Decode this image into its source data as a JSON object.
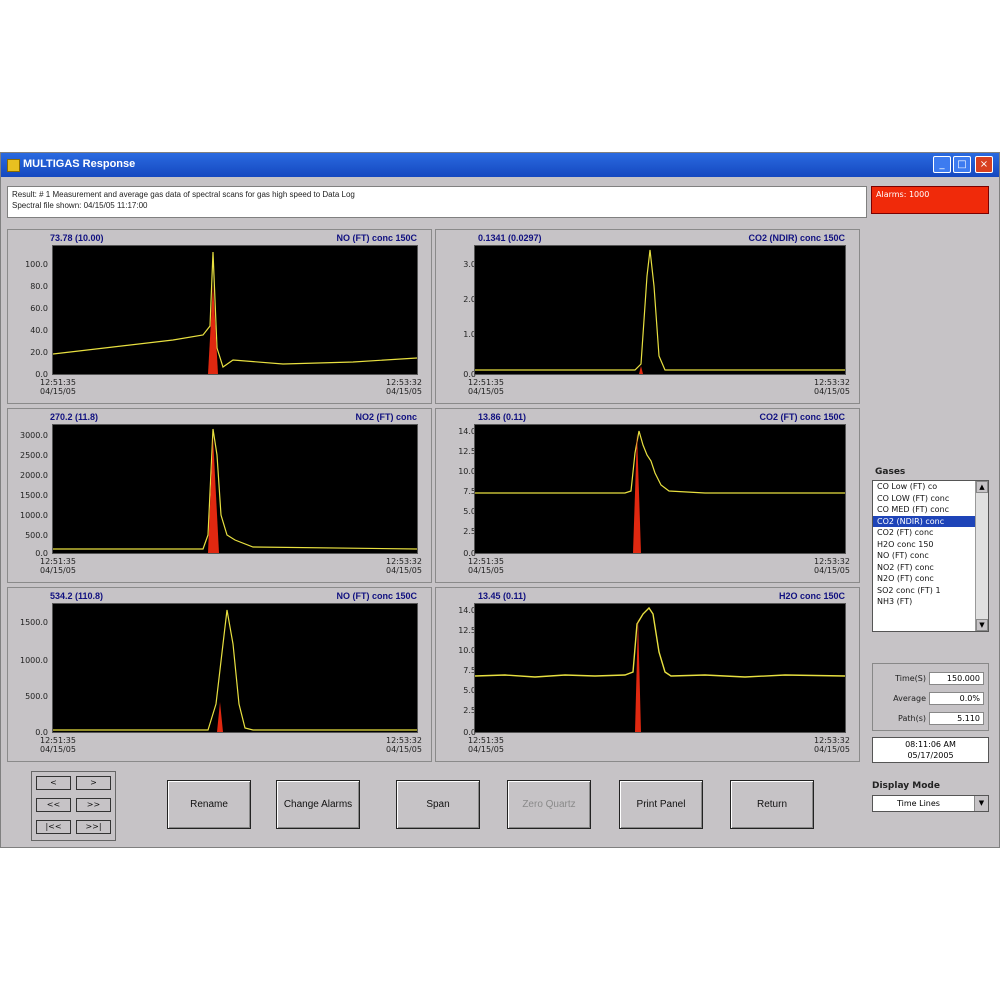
{
  "window": {
    "title": "MULTIGAS Response",
    "buttons": {
      "minimize": "_",
      "maximize": "□",
      "close": "×"
    }
  },
  "info": {
    "line1": "Result: # 1 Measurement and average gas data of spectral scans for gas high speed to Data Log",
    "line2": "Spectral file shown: 04/15/05 11:17:00"
  },
  "alarm": {
    "text": "Alarms: 1000"
  },
  "panels": [
    {
      "value_text": "73.78 (10.00)",
      "name_text": "NO (FT) conc 150C",
      "y_ticks": [
        "100.0",
        "80.0",
        "60.0",
        "40.0",
        "20.0",
        "0.0"
      ],
      "x_start": [
        "12:51:35",
        "04/15/05"
      ],
      "x_end": [
        "12:53:32",
        "04/15/05"
      ]
    },
    {
      "value_text": "0.1341 (0.0297)",
      "name_text": "CO2 (NDIR) conc 150C",
      "y_ticks": [
        "3.0",
        "2.0",
        "1.0",
        "0.0"
      ],
      "x_start": [
        "12:51:35",
        "04/15/05"
      ],
      "x_end": [
        "12:53:32",
        "04/15/05"
      ]
    },
    {
      "value_text": "270.2 (11.8)",
      "name_text": "NO2 (FT) conc",
      "y_ticks": [
        "3000.0",
        "2500.0",
        "2000.0",
        "1500.0",
        "1000.0",
        "500.0",
        "0.0"
      ],
      "x_start": [
        "12:51:35",
        "04/15/05"
      ],
      "x_end": [
        "12:53:32",
        "04/15/05"
      ]
    },
    {
      "value_text": "13.86 (0.11)",
      "name_text": "CO2 (FT) conc 150C",
      "y_ticks": [
        "14.0",
        "12.5",
        "10.0",
        "7.5",
        "5.0",
        "2.5",
        "0.0"
      ],
      "x_start": [
        "12:51:35",
        "04/15/05"
      ],
      "x_end": [
        "12:53:32",
        "04/15/05"
      ]
    },
    {
      "value_text": "534.2 (110.8)",
      "name_text": "NO (FT) conc 150C",
      "y_ticks": [
        "1500.0",
        "1000.0",
        "500.0",
        "0.0"
      ],
      "x_start": [
        "12:51:35",
        "04/15/05"
      ],
      "x_end": [
        "12:53:32",
        "04/15/05"
      ]
    },
    {
      "value_text": "13.45 (0.11)",
      "name_text": "H2O conc 150C",
      "y_ticks": [
        "14.0",
        "12.5",
        "10.0",
        "7.5",
        "5.0",
        "2.5",
        "0.0"
      ],
      "x_start": [
        "12:51:35",
        "04/15/05"
      ],
      "x_end": [
        "12:53:32",
        "04/15/05"
      ]
    }
  ],
  "gases": {
    "label": "Gases",
    "items": [
      "CO Low (FT) co",
      "CO LOW (FT) conc",
      "CO MED (FT) conc",
      "CO2 (NDIR) conc",
      "CO2 (FT) conc",
      "H2O conc 150",
      "NO (FT) conc",
      "NO2 (FT) conc",
      "N2O (FT) conc",
      "SO2 conc (FT) 1",
      "NH3 (FT)"
    ],
    "selected_index": 3
  },
  "stats": [
    {
      "label": "Time(S)",
      "value": "150.000"
    },
    {
      "label": "Average",
      "value": "0.0%"
    },
    {
      "label": "Path(s)",
      "value": "5.110"
    }
  ],
  "clock": {
    "time": "08:11:06 AM",
    "date": "05/17/2005"
  },
  "display_mode": {
    "label": "Display Mode",
    "value": "Time Lines"
  },
  "nav": [
    "<",
    ">",
    "<<",
    ">>",
    "|<<",
    ">>|"
  ],
  "buttons": [
    "Rename",
    "Change Alarms",
    "Span",
    "Zero Quartz",
    "Print Panel",
    "Return"
  ]
}
